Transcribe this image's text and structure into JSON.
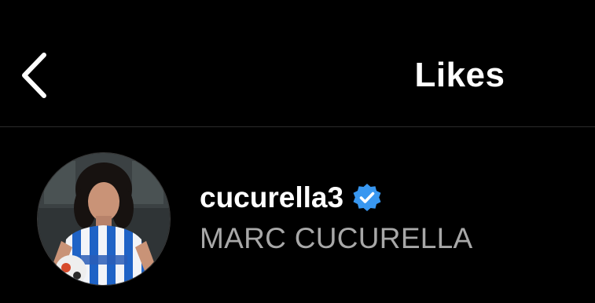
{
  "header": {
    "back_icon": "chevron-left-icon",
    "title": "Likes"
  },
  "likes": [
    {
      "username": "cucurella3",
      "verified": true,
      "verified_icon": "verified-badge-icon",
      "full_name": "MARC CUCURELLA",
      "avatar": "profile-photo"
    }
  ],
  "colors": {
    "background": "#000000",
    "text_primary": "#ffffff",
    "text_secondary": "#a8a8a8",
    "divider": "#2b2b2b",
    "verified_blue": "#3897f0"
  }
}
